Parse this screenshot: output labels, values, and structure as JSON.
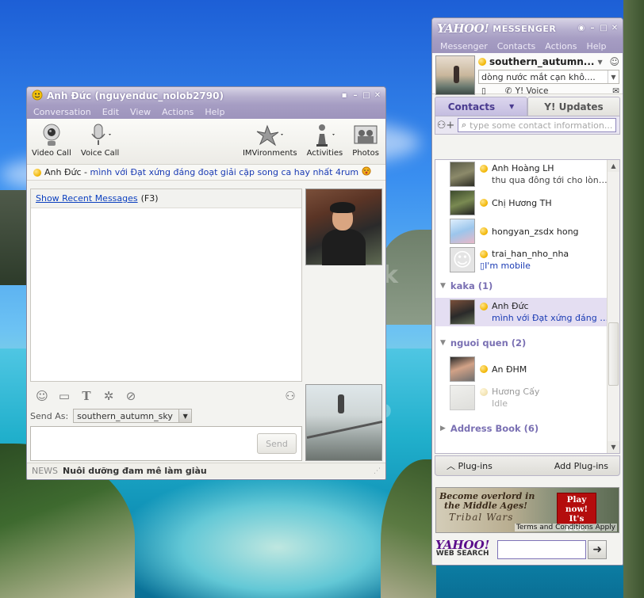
{
  "desktop": {
    "watermark_1": "otobuck",
    "watermark_2": "re of your memo"
  },
  "conversation": {
    "title": "Anh Đức (nguyenduc_nolob2790)",
    "menu": [
      "Conversation",
      "Edit",
      "View",
      "Actions",
      "Help"
    ],
    "toolbar": {
      "video_call": "Video Call",
      "voice_call": "Voice Call",
      "imvironments": "IMVironments",
      "activities": "Activities",
      "photos": "Photos"
    },
    "contact_name": "Anh Đức",
    "separator": " - ",
    "contact_status": "mình với Đạt xứng đáng đoạt giải cặp song ca hay nhất 4rum",
    "show_recent": "Show Recent Messages",
    "show_recent_key": "(F3)",
    "send_as_label": "Send As:",
    "send_as_value": "southern_autumn_sky",
    "send_button": "Send",
    "news_label": "NEWS",
    "news_headline": "Nuôi dưỡng đam mê làm giàu"
  },
  "messenger": {
    "logo": "YAHOO!",
    "title": "MESSENGER",
    "menu": [
      "Messenger",
      "Contacts",
      "Actions",
      "Help"
    ],
    "me_name": "southern_autumn...",
    "me_status": "dòng nước mắt cạn khô....",
    "voice": "Y! Voice",
    "tab_contacts": "Contacts",
    "tab_updates": "Y! Updates",
    "search_placeholder": "type some contact information...",
    "contacts": [
      {
        "name": "Anh Hoàng LH",
        "status": "thu qua đông tới cho lòng b ..."
      },
      {
        "name": "Chị Hương TH",
        "status": ""
      },
      {
        "name": "hongyan_zsdx hong",
        "status": ""
      },
      {
        "name": "trai_han_nho_nha",
        "status": "I'm mobile"
      }
    ],
    "group_kaka": "kaka (1)",
    "kaka_contacts": [
      {
        "name": "Anh Đức",
        "status": "mình với Đạt xứng đáng đo ..."
      }
    ],
    "group_nguoi_quen": "nguoi quen (2)",
    "nguoi_quen_contacts": [
      {
        "name": "An ĐHM",
        "status": ""
      },
      {
        "name": "Hương Cấy",
        "status": "Idle"
      }
    ],
    "group_address_book": "Address Book (6)",
    "plugins": "Plug-ins",
    "add_plugins": "Add Plug-ins",
    "ad": {
      "line1": "Become overlord in",
      "line2": "the Middle Ages!",
      "brand": "Tribal Wars",
      "play": "Play now! It's free!",
      "terms": "Terms and Conditions Apply"
    },
    "websearch_logo": "YAHOO!",
    "websearch_label": "WEB SEARCH"
  }
}
